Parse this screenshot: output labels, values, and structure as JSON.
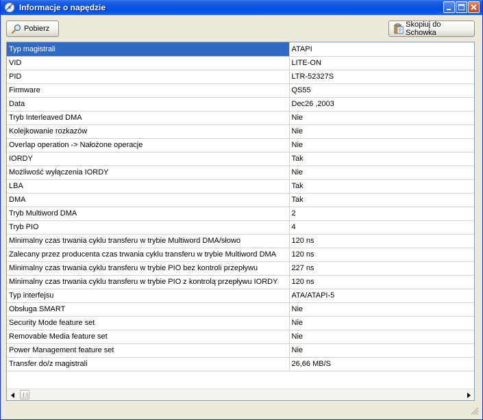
{
  "window": {
    "title": "Informacje o napędzie"
  },
  "toolbar": {
    "get_label": "Pobierz",
    "copy_label": "Skopiuj do Schowka"
  },
  "rows": [
    {
      "name": "Typ magistrali",
      "value": "ATAPI"
    },
    {
      "name": "VID",
      "value": "LITE-ON"
    },
    {
      "name": "PID",
      "value": "LTR-52327S"
    },
    {
      "name": "Firmware",
      "value": "QS55"
    },
    {
      "name": "Data",
      "value": "Dec26 ,2003"
    },
    {
      "name": "Tryb Interleaved DMA",
      "value": "Nie"
    },
    {
      "name": "Kolejkowanie rozkazów",
      "value": "Nie"
    },
    {
      "name": "Overlap operation -> Nałożone operacje",
      "value": "Nie"
    },
    {
      "name": "IORDY",
      "value": "Tak"
    },
    {
      "name": "Możliwość wyłączenia IORDY",
      "value": "Nie"
    },
    {
      "name": "LBA",
      "value": "Tak"
    },
    {
      "name": "DMA",
      "value": "Tak"
    },
    {
      "name": "Tryb Multiword DMA",
      "value": "2"
    },
    {
      "name": "Tryb PIO",
      "value": "4"
    },
    {
      "name": "Minimalny czas trwania cyklu transferu w trybie Multiword DMA/słowo",
      "value": "120 ns"
    },
    {
      "name": "Zalecany przez producenta  czas trwania cyklu transferu w trybie Multiword DMA",
      "value": "120 ns"
    },
    {
      "name": "Minimalny czas trwania cyklu transferu w trybie PIO bez kontroli przepływu",
      "value": "227 ns"
    },
    {
      "name": "Minimalny czas trwania cyklu transferu w trybie PIO z kontrolą przepływu IORDY",
      "value": "120 ns"
    },
    {
      "name": "Typ interfejsu",
      "value": "ATA/ATAPI-5"
    },
    {
      "name": "Obsługa SMART",
      "value": "Nie"
    },
    {
      "name": "Security Mode feature set",
      "value": "Nie"
    },
    {
      "name": "Removable Media feature set",
      "value": "Nie"
    },
    {
      "name": "Power Management feature set",
      "value": "Nie"
    },
    {
      "name": "Transfer do/z magistrali",
      "value": "26,66 MB/S"
    }
  ]
}
